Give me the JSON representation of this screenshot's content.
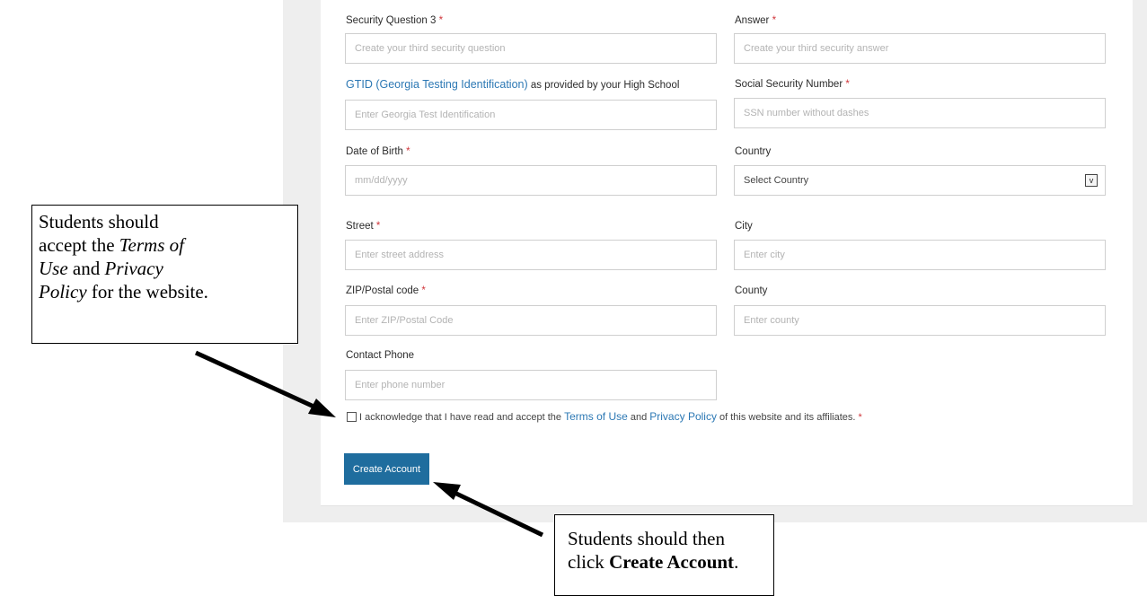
{
  "form": {
    "security_question_3": {
      "label": "Security Question 3",
      "required": "*",
      "placeholder": "Create your third security question"
    },
    "answer": {
      "label": "Answer",
      "required": "*",
      "placeholder": "Create your third security answer"
    },
    "gtid": {
      "link_text": "GTID (Georgia Testing Identification)",
      "label_suffix": " as provided by your High School",
      "placeholder": "Enter Georgia Test Identification"
    },
    "ssn": {
      "label": "Social Security Number",
      "required": "*",
      "placeholder": "SSN number without dashes"
    },
    "dob": {
      "label": "Date of Birth",
      "required": "*",
      "placeholder": "mm/dd/yyyy"
    },
    "country": {
      "label": "Country",
      "selected": "Select Country",
      "arrow": "v"
    },
    "street": {
      "label": "Street",
      "required": "*",
      "placeholder": "Enter street address"
    },
    "city": {
      "label": "City",
      "placeholder": "Enter city"
    },
    "zip": {
      "label": "ZIP/Postal code",
      "required": "*",
      "placeholder": "Enter ZIP/Postal Code"
    },
    "county": {
      "label": "County",
      "placeholder": "Enter county"
    },
    "phone": {
      "label": "Contact Phone",
      "placeholder": "Enter phone number"
    },
    "acknowledge": {
      "prefix": "I acknowledge that I have read and accept the ",
      "terms_link": "Terms of Use",
      "and": " and ",
      "privacy_link": "Privacy Policy",
      "suffix": " of this website and its affiliates.",
      "required": "*"
    },
    "submit_label": "Create Account"
  },
  "callouts": {
    "terms": {
      "line1": "Students should",
      "line2_prefix": "accept the ",
      "line2_italic": "Terms of",
      "line3_italic": "Use",
      "line3_mid": " and ",
      "line3_italic2": "Privacy",
      "line4_italic": "Policy",
      "line4_suffix": " for the website."
    },
    "create": {
      "line1": "Students should then",
      "line2_prefix": "click ",
      "line2_bold": "Create Account",
      "line2_suffix": "."
    }
  },
  "colors": {
    "link": "#2c78b4",
    "required": "#d0363b",
    "button": "#1f6d9e",
    "page_background": "#eeeeee"
  }
}
